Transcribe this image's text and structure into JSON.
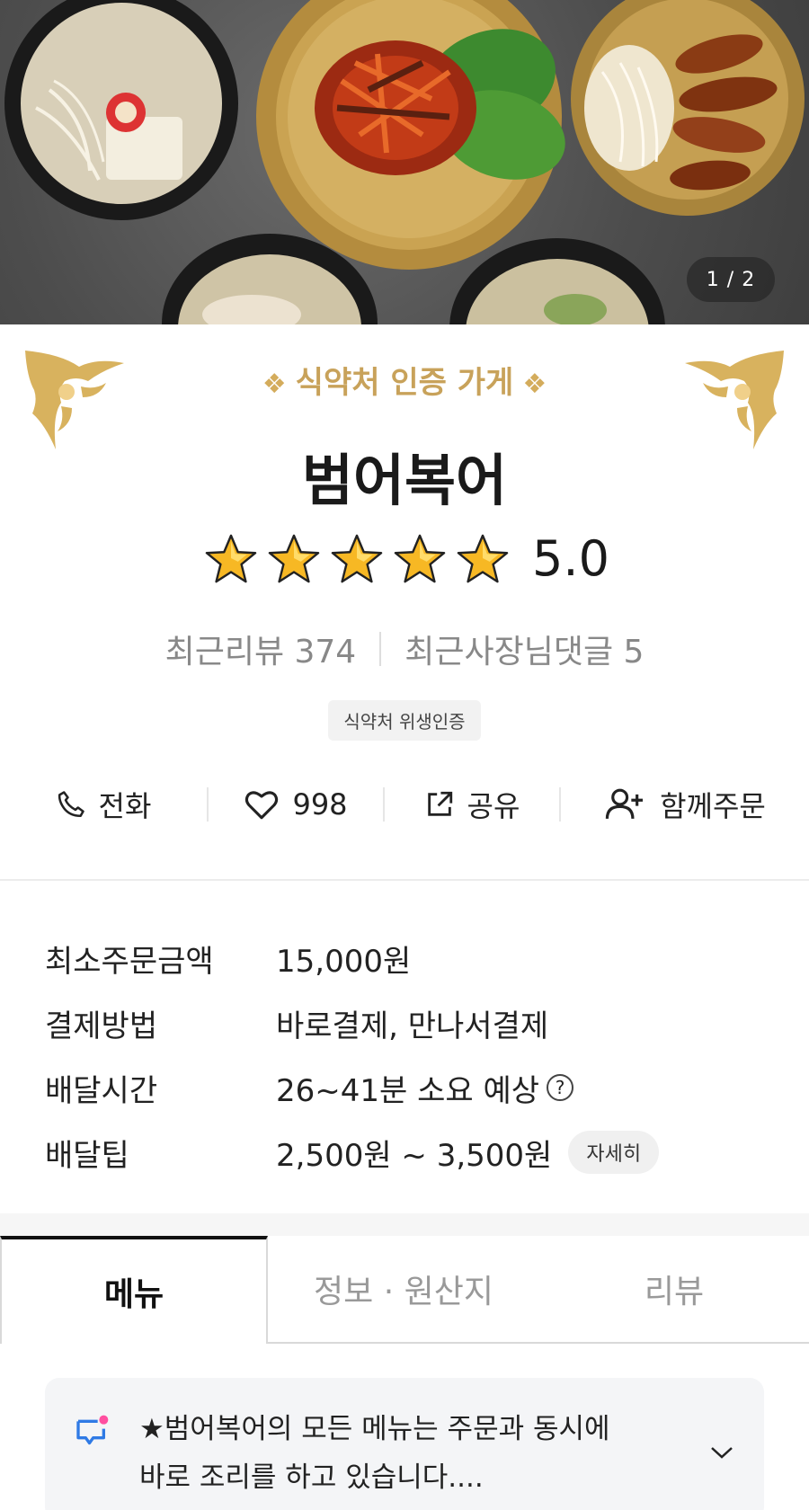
{
  "hero": {
    "pager": "1 / 2"
  },
  "store": {
    "certification_label": "식약처 인증 가게",
    "name": "범어복어",
    "rating": "5.0",
    "stars": 5,
    "recent_reviews": "최근리뷰 374",
    "owner_comments": "최근사장님댓글 5",
    "badge": "식약처 위생인증"
  },
  "actions": {
    "call": "전화",
    "likes": "998",
    "share": "공유",
    "group_order": "함께주문"
  },
  "info": {
    "min_order_label": "최소주문금액",
    "min_order_value": "15,000원",
    "payment_label": "결제방법",
    "payment_value": "바로결제, 만나서결제",
    "delivery_time_label": "배달시간",
    "delivery_time_value": "26~41분 소요 예상",
    "delivery_tip_label": "배달팁",
    "delivery_tip_value": "2,500원 ~ 3,500원",
    "detail_button": "자세히",
    "help_glyph": "?"
  },
  "tabs": [
    {
      "label": "메뉴",
      "active": true
    },
    {
      "label": "정보 · 원산지",
      "active": false
    },
    {
      "label": "리뷰",
      "active": false
    }
  ],
  "notice": {
    "line1": "★범어복어의 모든 메뉴는 주문과 동시에",
    "line2": "바로 조리를 하고 있습니다...."
  },
  "colors": {
    "gold": "#c8a25a",
    "accent_blue": "#2f7ae5",
    "notice_dot": "#ff4fa0"
  }
}
